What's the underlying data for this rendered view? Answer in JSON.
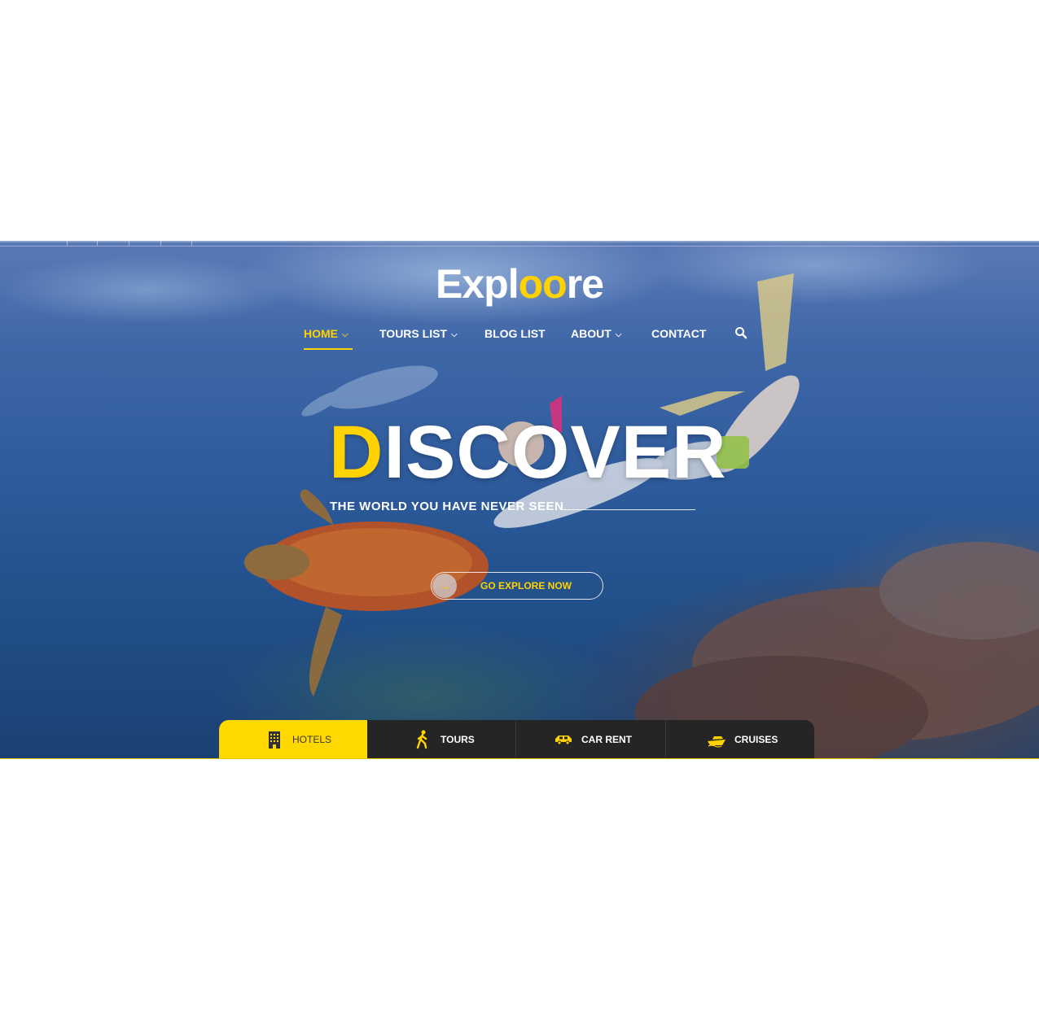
{
  "brand": {
    "logo_pre": "Expl",
    "logo_oo": "oo",
    "logo_post": "re"
  },
  "nav": {
    "items": [
      {
        "label": "HOME",
        "has_dropdown": true,
        "active": true
      },
      {
        "label": "TOURS LIST",
        "has_dropdown": true
      },
      {
        "label": "BLOG LIST",
        "has_dropdown": false
      },
      {
        "label": "ABOUT",
        "has_dropdown": true
      },
      {
        "label": "CONTACT",
        "has_dropdown": false
      }
    ],
    "dropdown_icon": "chevron-down-icon",
    "search_icon": "search-icon"
  },
  "hero": {
    "headline_first": "D",
    "headline_rest": "ISCOVER",
    "subtitle": "THE WORLD YOU HAVE NEVER SEEN",
    "cta_label": "GO EXPLORE NOW",
    "cta_icon": "arrow-right-icon"
  },
  "tabs": [
    {
      "label": "HOTELS",
      "icon": "hotel-building-icon",
      "active": true
    },
    {
      "label": "TOURS",
      "icon": "hiker-icon"
    },
    {
      "label": "CAR RENT",
      "icon": "car-icon"
    },
    {
      "label": "CRUISES",
      "icon": "ship-icon"
    }
  ],
  "colors": {
    "accent": "#ffd200",
    "tab_bar": "#252526",
    "text": "#ffffff"
  }
}
